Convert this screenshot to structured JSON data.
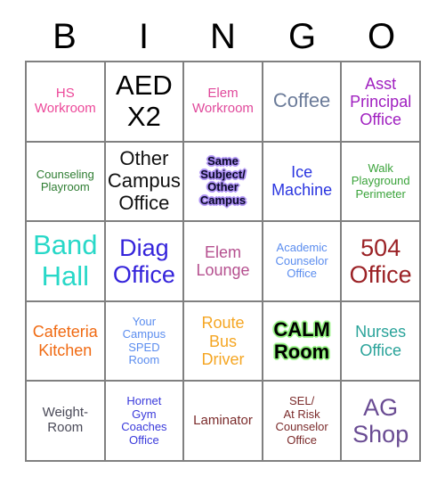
{
  "header": {
    "letters": [
      "B",
      "I",
      "N",
      "G",
      "O"
    ]
  },
  "grid": {
    "rows": 5,
    "columns": 5,
    "border_color": "#808080",
    "background": "#ffffff",
    "cells": [
      {
        "text": "HS\nWorkroom",
        "color": "#EC4899",
        "size": "sz-sm",
        "bold": false,
        "effect": "none"
      },
      {
        "text": "AED\nX2",
        "color": "#000000",
        "size": "sz-xxl",
        "bold": false,
        "effect": "none"
      },
      {
        "text": "Elem\nWorkroom",
        "color": "#E0499B",
        "size": "sz-sm",
        "bold": false,
        "effect": "none"
      },
      {
        "text": "Coffee",
        "color": "#6B7B99",
        "size": "sz-lg",
        "bold": false,
        "effect": "none"
      },
      {
        "text": "Asst\nPrincipal\nOffice",
        "color": "#A020C0",
        "size": "sz-md",
        "bold": false,
        "effect": "none"
      },
      {
        "text": "Counseling\nPlayroom",
        "color": "#2E7D32",
        "size": "sz-xs",
        "bold": false,
        "effect": "none"
      },
      {
        "text": "Other\nCampus\nOffice",
        "color": "#111111",
        "size": "sz-lg",
        "bold": false,
        "effect": "none"
      },
      {
        "text": "Same\nSubject/\nOther\nCampus",
        "color": "#0A0A28",
        "size": "sz-xs",
        "bold": true,
        "effect": "glow-purple"
      },
      {
        "text": "Ice\nMachine",
        "color": "#2A35E0",
        "size": "sz-md",
        "bold": false,
        "effect": "none"
      },
      {
        "text": "Walk\nPlayground\nPerimeter",
        "color": "#3AA33A",
        "size": "sz-xs",
        "bold": false,
        "effect": "none"
      },
      {
        "text": "Band\nHall",
        "color": "#28D8C8",
        "size": "sz-xxl",
        "bold": false,
        "effect": "none"
      },
      {
        "text": "Diag\nOffice",
        "color": "#3524DB",
        "size": "sz-xl",
        "bold": false,
        "effect": "none"
      },
      {
        "text": "Elem\nLounge",
        "color": "#B5508F",
        "size": "sz-md",
        "bold": false,
        "effect": "none"
      },
      {
        "text": "Academic\nCounselor\nOffice",
        "color": "#5B8DEF",
        "size": "sz-xs",
        "bold": false,
        "effect": "none"
      },
      {
        "text": "504\nOffice",
        "color": "#9B2226",
        "size": "sz-xl",
        "bold": false,
        "effect": "none"
      },
      {
        "text": "Cafeteria\nKitchen",
        "color": "#F06A12",
        "size": "sz-md",
        "bold": false,
        "effect": "none"
      },
      {
        "text": "Your\nCampus\nSPED\nRoom",
        "color": "#5B8DEF",
        "size": "sz-xs",
        "bold": false,
        "effect": "none"
      },
      {
        "text": "Route\nBus\nDriver",
        "color": "#F5A623",
        "size": "sz-md",
        "bold": false,
        "effect": "none"
      },
      {
        "text": "CALM\nRoom",
        "color": "#000000",
        "size": "sz-lg",
        "bold": true,
        "effect": "glow-green"
      },
      {
        "text": "Nurses\nOffice",
        "color": "#2AA39A",
        "size": "sz-md",
        "bold": false,
        "effect": "none"
      },
      {
        "text": "Weight-\nRoom",
        "color": "#4A4A58",
        "size": "sz-sm",
        "bold": false,
        "effect": "none"
      },
      {
        "text": "Hornet\nGym\nCoaches\nOffice",
        "color": "#3A3ADB",
        "size": "sz-xs",
        "bold": false,
        "effect": "none"
      },
      {
        "text": "Laminator",
        "color": "#7B2B2B",
        "size": "sz-sm",
        "bold": false,
        "effect": "none"
      },
      {
        "text": "SEL/\nAt Risk\nCounselor\nOffice",
        "color": "#7B2B2B",
        "size": "sz-xs",
        "bold": false,
        "effect": "none"
      },
      {
        "text": "AG\nShop",
        "color": "#6A4C93",
        "size": "sz-xl",
        "bold": false,
        "effect": "none"
      }
    ]
  }
}
